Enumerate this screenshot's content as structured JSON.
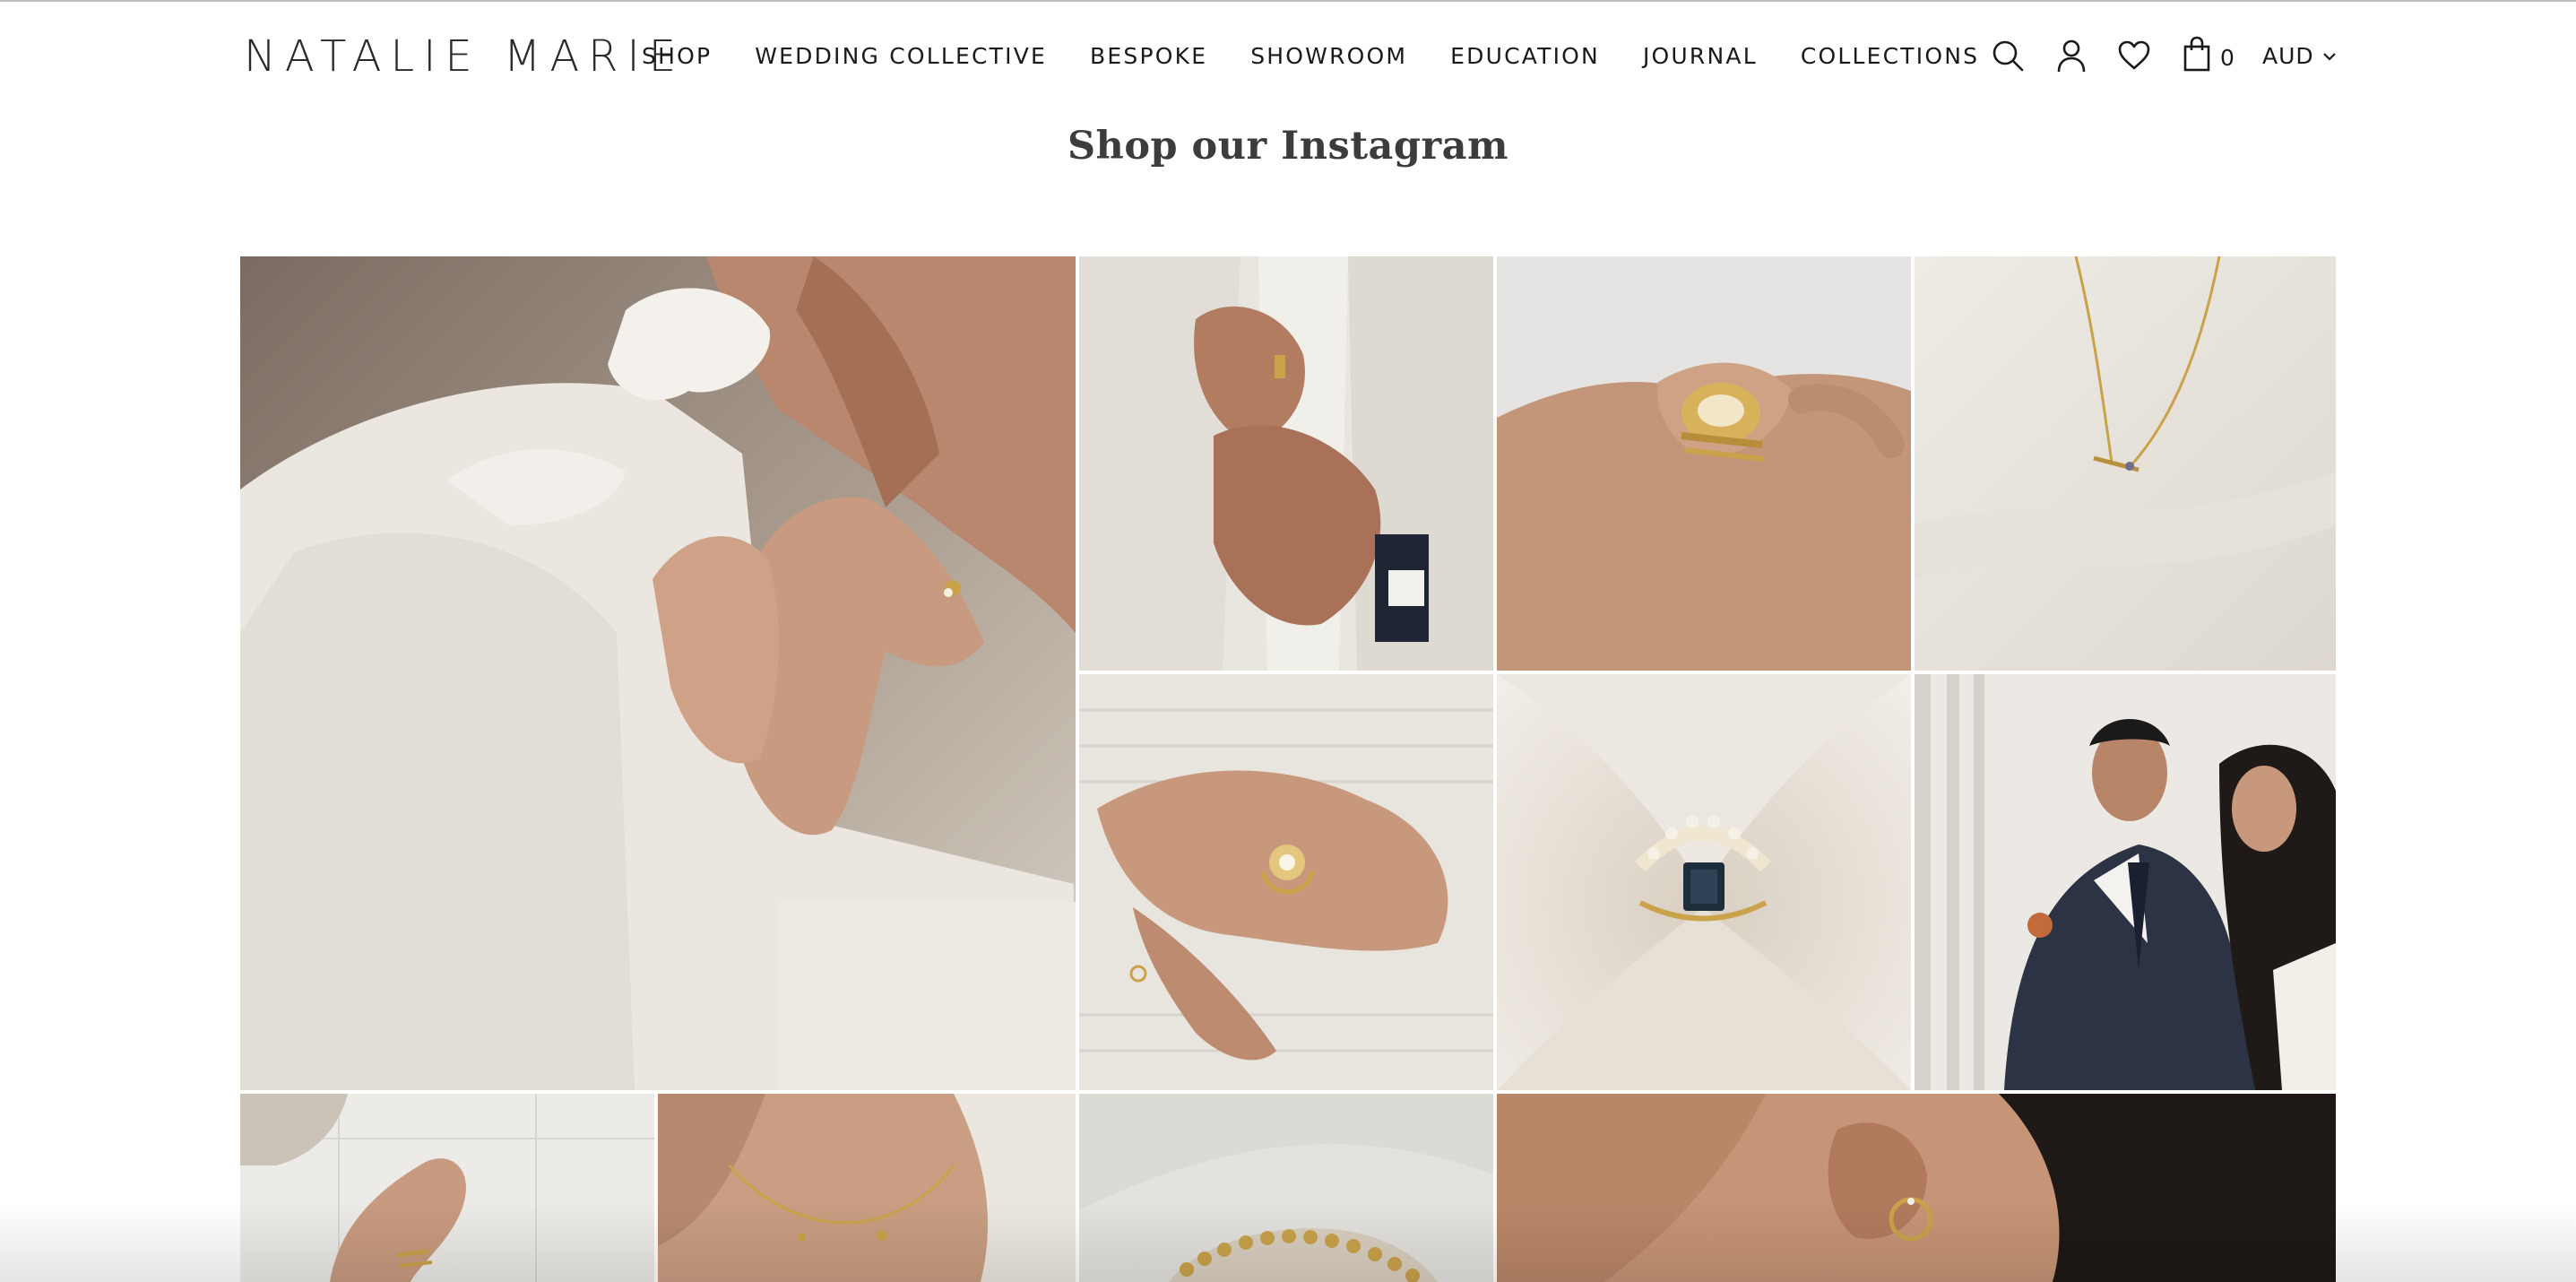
{
  "brand": {
    "logo_text": "NATALIE MARIE"
  },
  "nav": {
    "items": [
      {
        "label": "SHOP"
      },
      {
        "label": "WEDDING COLLECTIVE"
      },
      {
        "label": "BESPOKE"
      },
      {
        "label": "SHOWROOM"
      },
      {
        "label": "EDUCATION"
      },
      {
        "label": "JOURNAL"
      },
      {
        "label": "COLLECTIONS"
      }
    ]
  },
  "header_icons": {
    "search": "search-icon",
    "account": "user-icon",
    "wishlist": "heart-icon",
    "cart": "shopping-bag-icon",
    "cart_count": "0",
    "currency": "AUD"
  },
  "section": {
    "title": "Shop our Instagram"
  },
  "instagram": {
    "tiles": [
      {
        "subject": "woman-earring-bow"
      },
      {
        "subject": "groom-hands-ring"
      },
      {
        "subject": "hand-marquise-ring-stack"
      },
      {
        "subject": "gold-necklace-on-satin"
      },
      {
        "subject": "hands-fan-ring"
      },
      {
        "subject": "sapphire-ring-on-satin"
      },
      {
        "subject": "couple-portrait"
      },
      {
        "subject": "hand-stacked-rings"
      },
      {
        "subject": "necklace-on-neck"
      },
      {
        "subject": "ring-on-tray"
      },
      {
        "subject": "ear-hoop-earring"
      }
    ]
  },
  "colors": {
    "text": "#1a1a1a",
    "title": "#3c3c3c",
    "background": "#ffffff",
    "ivory": "#ece8e2",
    "skin": "#c89b80",
    "gold": "#c9a24a"
  }
}
